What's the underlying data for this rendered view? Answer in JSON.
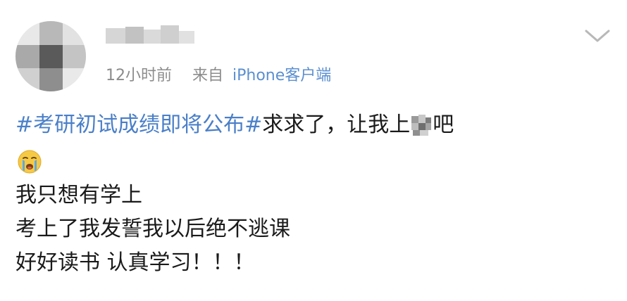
{
  "post": {
    "meta": {
      "time": "12小时前",
      "from_label": "来自",
      "client": "iPhone客户端"
    },
    "content": {
      "hashtag": "#考研初试成绩即将公布#",
      "line1_text_before": "求求了，让我上",
      "line1_text_after": "吧",
      "line2": "我只想有学上",
      "line3": "考上了我发誓我以后绝不逃课",
      "line4": "好好读书 认真学习！！！"
    },
    "icons": {
      "avatar": "blurred-avatar",
      "username": "blurred-username",
      "chevron": "chevron-down-icon",
      "emoji": "crying-face-icon",
      "censor": "pixelated-censor"
    },
    "colors": {
      "link": "#4a7fc8",
      "meta": "#8c8c8c",
      "client": "#5b8fd0",
      "emoji_face": "#f6c945",
      "tears": "#5aa9e6"
    }
  }
}
